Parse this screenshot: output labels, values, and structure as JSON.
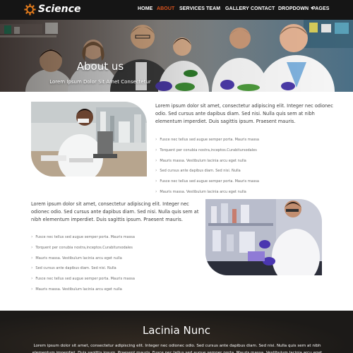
{
  "brand": {
    "name": "Science",
    "icon": "gear-icon",
    "accent": "#d9531e"
  },
  "nav": {
    "items": [
      {
        "label": "HOME"
      },
      {
        "label": "ABOUT",
        "active": true
      },
      {
        "label": "SERVICES"
      },
      {
        "label": "TEAM"
      },
      {
        "label": "GALLERY"
      },
      {
        "label": "CONTACT"
      },
      {
        "label": "DROPDOWN",
        "icon": "chevron-down-icon"
      },
      {
        "label": "PAGES"
      }
    ]
  },
  "hero": {
    "title": "About us",
    "subtitle": "Lorem Ipsum Dolor Sit Amet Consectetur"
  },
  "section1": {
    "paragraph": "Lorem ipsum dolor sit amet, consectetur adipiscing elit. Integer nec odionec odio. Sed cursus ante dapibus diam. Sed nisi. Nulla quis sem at nibh elementum imperdiet. Duis sagittis ipsum. Praesent mauris.",
    "list": [
      "Fusce nec tellus sed augue semper porta. Mauris massa",
      "Torquent per conubia nostra,inceptos.Curabitursodales",
      "Mauris massa. Vestibulum lacinia arcu eget nulla",
      "Sed cursus ante dapibus diam. Sed nisi. Nulla",
      "Fusce nec tellus sed augue semper porta. Mauris massa",
      "Mauris massa. Vestibulum lacinia arcu eget nulla"
    ]
  },
  "section2": {
    "paragraph": "Lorem ipsum dolor sit amet, consectetur adipiscing elit. Integer nec odionec odio. Sed cursus ante dapibus diam. Sed nisi. Nulla quis sem at nibh elementum imperdiet. Duis sagittis ipsum. Praesent mauris.",
    "list": [
      "Fusce nec tellus sed augue semper porta. Mauris massa",
      "Torquent per conubia nostra,inceptos.Curabitursodales",
      "Mauris massa. Vestibulum lacinia arcu eget nulla",
      "Sed cursus ante dapibus diam. Sed nisi. Nulla",
      "Fusce nec tellus sed augue semper porta. Mauris massa",
      "Mauris massa. Vestibulum lacinia arcu eget nulla"
    ]
  },
  "band": {
    "title": "Lacinia Nunc",
    "text": "Lorem ipsum dolor sit amet, consectetur adipiscing elit. Integer nec odionec odio. Sed cursus ante dapibus diam. Sed nisi. Nulla quis sem at nibh elementum imperdiet. Duis sagittis ipsum. Praesent mauris. Fusce nec tellus sed augue semper porta. Mauris massa. Vestibulum lacinia arcu eget nulla. torquent per"
  }
}
